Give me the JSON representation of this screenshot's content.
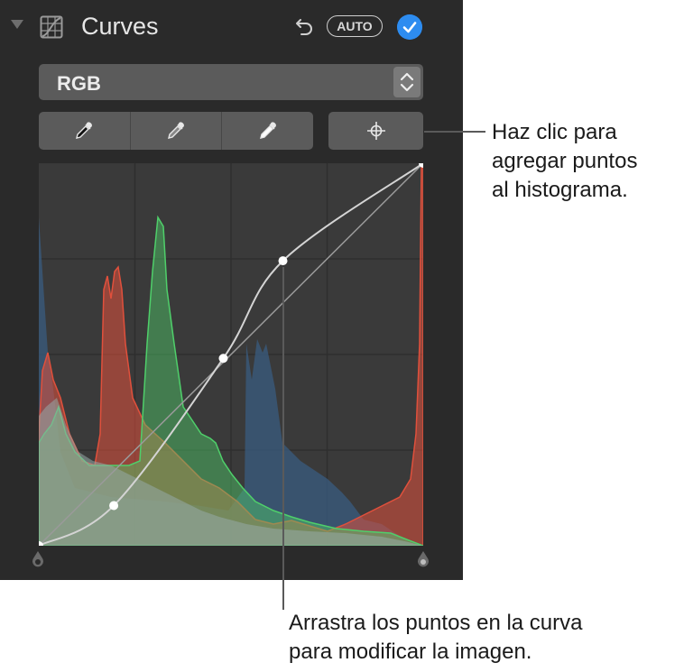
{
  "panel": {
    "title": "Curves",
    "auto_label": "AUTO",
    "channel_select": {
      "value": "RGB"
    },
    "eyedroppers": [
      {
        "name": "black-point"
      },
      {
        "name": "gray-point"
      },
      {
        "name": "white-point"
      }
    ],
    "colors": {
      "background": "#2a2a2a",
      "accent": "#2d8cf0",
      "red": "#e0503c",
      "green": "#4fcf6a",
      "blue": "#3a5c80",
      "luminance": "#8a9a98",
      "curve": "#d0d0d0"
    }
  },
  "curve_points": [
    {
      "x": 0.0,
      "y": 0.0
    },
    {
      "x": 0.195,
      "y": 0.105
    },
    {
      "x": 0.48,
      "y": 0.49
    },
    {
      "x": 0.635,
      "y": 0.745
    },
    {
      "x": 1.0,
      "y": 1.0
    }
  ],
  "callouts": {
    "add_points": [
      "Haz clic para",
      "agregar puntos",
      "al histograma."
    ],
    "drag_points": [
      "Arrastra los puntos en la curva",
      "para modificar la imagen."
    ]
  }
}
